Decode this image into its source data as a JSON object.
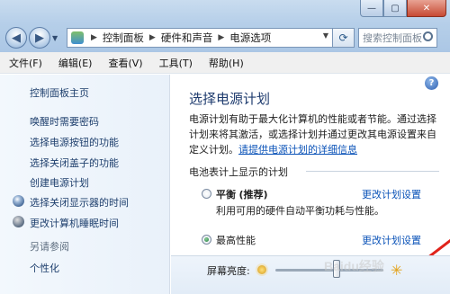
{
  "window": {
    "controls": {
      "minimize": "—",
      "maximize": "▢",
      "close": "✕"
    }
  },
  "nav": {
    "back_icon": "back-arrow-icon",
    "forward_icon": "forward-arrow-icon",
    "breadcrumb": [
      "控制面板",
      "硬件和声音",
      "电源选项"
    ],
    "search_placeholder": "搜索控制面板"
  },
  "menu": [
    "文件(F)",
    "编辑(E)",
    "查看(V)",
    "工具(T)",
    "帮助(H)"
  ],
  "sidebar": {
    "home": "控制面板主页",
    "items": [
      "唤醒时需要密码",
      "选择电源按钮的功能",
      "选择关闭盖子的功能",
      "创建电源计划",
      "选择关闭显示器的时间",
      "更改计算机睡眠时间"
    ],
    "see_also": "另请参阅",
    "personalize": "个性化"
  },
  "main": {
    "help": "?",
    "title": "选择电源计划",
    "description": "电源计划有助于最大化计算机的性能或者节能。通过选择计划来将其激活，或选择计划并通过更改其电源设置来自定义计划。",
    "description_link": "请提供电源计划的详细信息",
    "section": "电池表计上显示的计划",
    "plans": [
      {
        "name": "平衡",
        "suffix": "(推荐)",
        "change": "更改计划设置",
        "desc": "利用可用的硬件自动平衡功耗与性能。",
        "selected": false
      },
      {
        "name": "最高性能",
        "suffix": "",
        "change": "更改计划设置",
        "desc": "",
        "selected": true
      }
    ],
    "brightness_label": "屏幕亮度:"
  },
  "watermark": "Baidu经验"
}
